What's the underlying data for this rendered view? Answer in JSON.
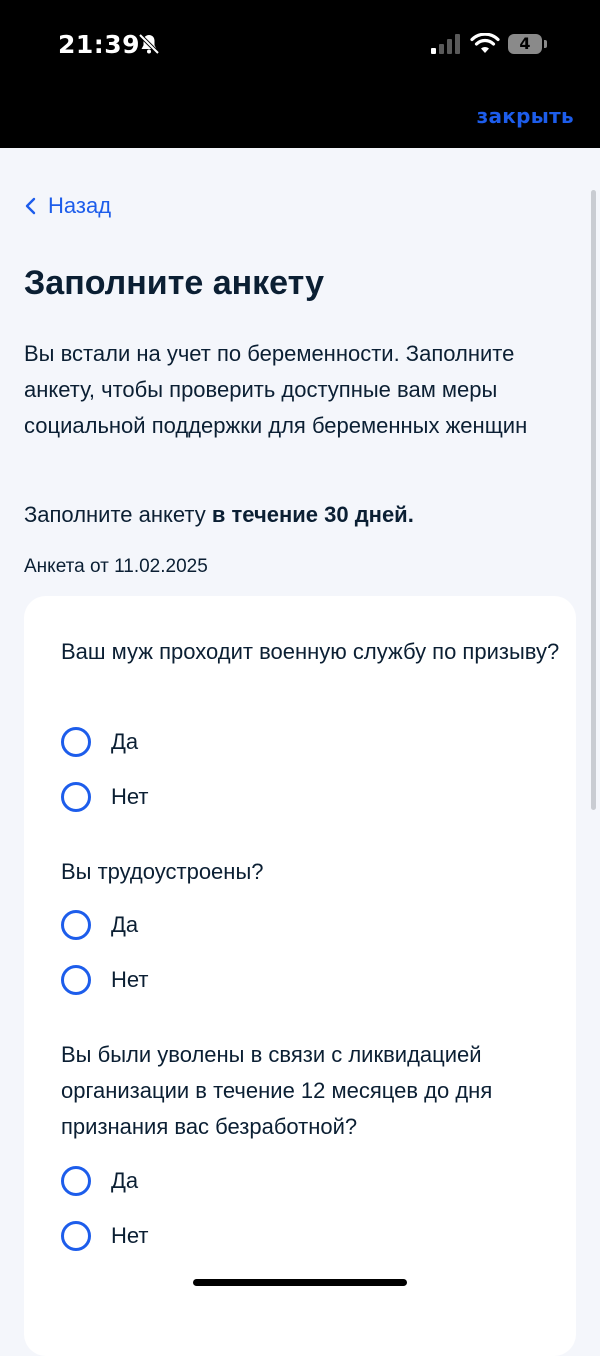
{
  "status_bar": {
    "time": "21:39",
    "battery_level": "4",
    "icons": [
      "bell-slash-icon",
      "signal-icon",
      "wifi-icon",
      "battery-icon"
    ]
  },
  "header": {
    "close_label": "закрыть"
  },
  "nav": {
    "back_label": "Назад"
  },
  "page": {
    "title": "Заполните анкету",
    "description": "Вы встали на учет по беременности. Заполните анкету, чтобы проверить доступные вам меры социальной поддержки для беременных женщин",
    "deadline_prefix": "Заполните анкету ",
    "deadline_bold": "в течение 30 дней.",
    "form_date": "Анкета от 11.02.2025"
  },
  "questions": [
    {
      "text": "Ваш муж проходит военную службу по призыву?",
      "options": [
        "Да",
        "Нет"
      ]
    },
    {
      "text": "Вы трудоустроены?",
      "options": [
        "Да",
        "Нет"
      ]
    },
    {
      "text": "Вы были уволены в связи с ликвидацией организации в течение 12 месяцев до дня признания вас безработной?",
      "options": [
        "Да",
        "Нет"
      ]
    }
  ],
  "colors": {
    "accent": "#1d5deb",
    "text": "#0b1f33",
    "background": "#f4f6fb",
    "card": "#ffffff"
  }
}
